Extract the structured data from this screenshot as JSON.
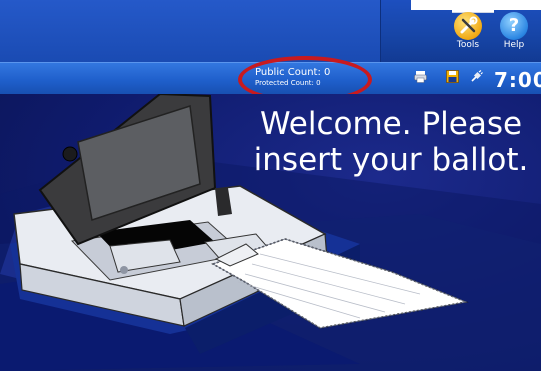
{
  "header": {
    "tools_label": "Tools",
    "help_label": "Help",
    "tools_icon": "tools-icon",
    "help_icon": "help-icon"
  },
  "status": {
    "public_count": "Public Count: 0",
    "protected_count": "Protected Count: 0",
    "time": "7:00",
    "icons": [
      "printer-icon",
      "save-icon",
      "power-plug-icon"
    ]
  },
  "main": {
    "welcome_text": "Welcome. Please\ninsert your ballot."
  },
  "colors": {
    "header_blue": "#1d4fbf",
    "status_blue": "#2a6bd8",
    "body_navy": "#0f1b6d",
    "highlight_red": "#c81a1f"
  }
}
